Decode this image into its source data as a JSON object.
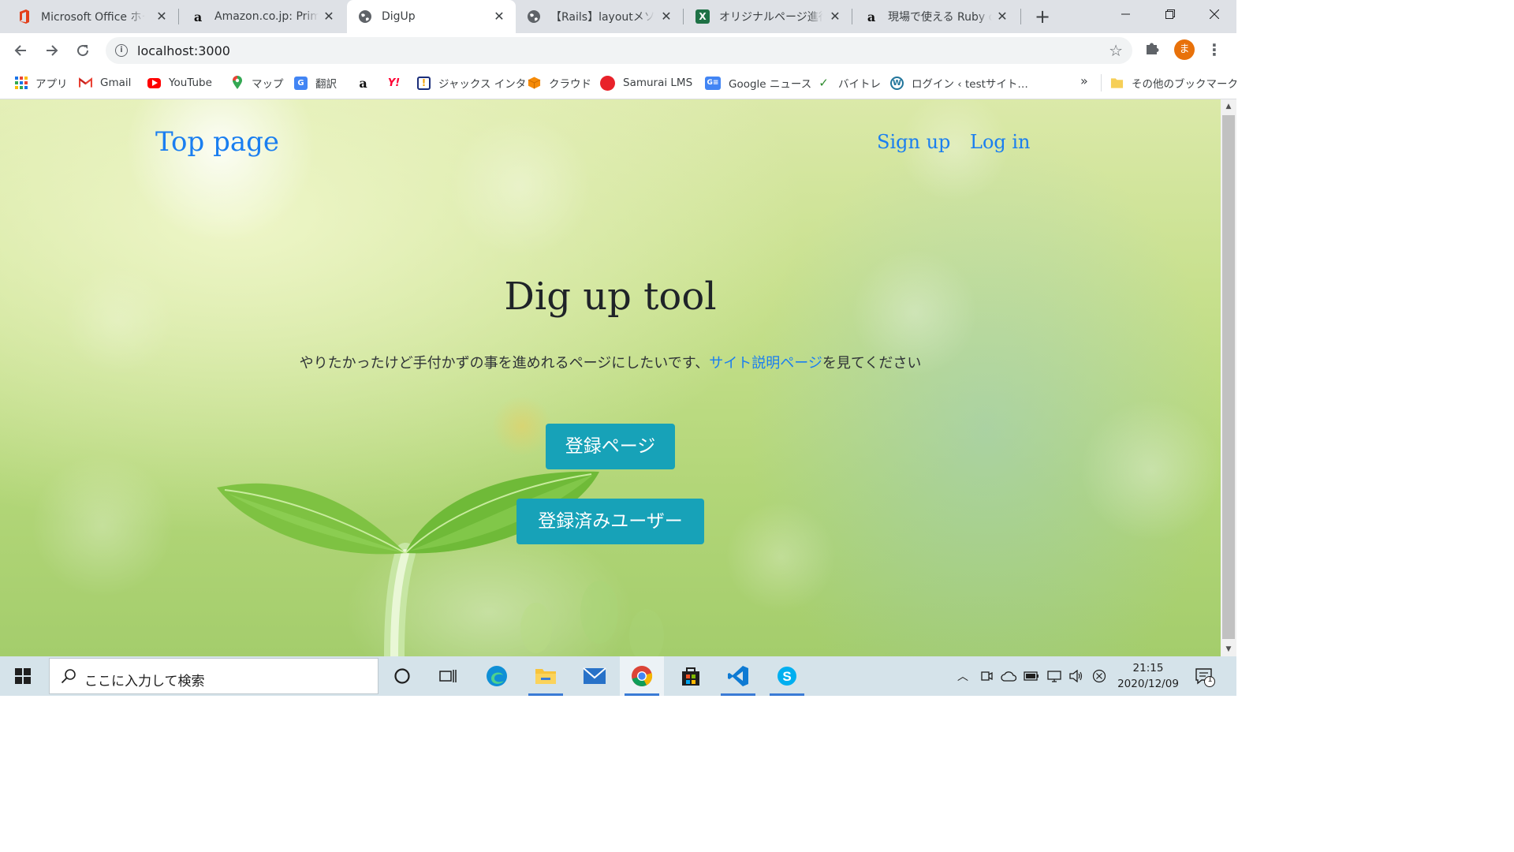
{
  "browser": {
    "tabs": [
      {
        "title": "Microsoft Office ホーム",
        "icon": "office-icon"
      },
      {
        "title": "Amazon.co.jp: Prime",
        "icon": "amazon-icon"
      },
      {
        "title": "DigUp",
        "icon": "globe-icon",
        "active": true
      },
      {
        "title": "【Rails】layoutメソッドの",
        "icon": "globe-icon"
      },
      {
        "title": "オリジナルページ進行メモ",
        "icon": "excel-icon"
      },
      {
        "title": "現場で使える Ruby on",
        "icon": "amazon-icon"
      }
    ],
    "url": "localhost:3000",
    "profile_initial": "ま",
    "bookmarks": [
      {
        "label": "アプリ",
        "icon": "apps-grid-icon"
      },
      {
        "label": "Gmail",
        "icon": "gmail-icon"
      },
      {
        "label": "YouTube",
        "icon": "youtube-icon"
      },
      {
        "label": "マップ",
        "icon": "maps-pin-icon"
      },
      {
        "label": "翻訳",
        "icon": "translate-icon"
      },
      {
        "label": "",
        "icon": "amazon-icon"
      },
      {
        "label": "",
        "icon": "yahoo-icon"
      },
      {
        "label": "ジャックス インタ",
        "icon": "jaccs-icon"
      },
      {
        "label": "クラウド",
        "icon": "cloud-box-icon"
      },
      {
        "label": "Samurai LMS",
        "icon": "samurai-icon"
      },
      {
        "label": "Google ニュース",
        "icon": "google-news-icon"
      },
      {
        "label": "バイトレ",
        "icon": "baitore-icon"
      },
      {
        "label": "ログイン ‹ testサイト…",
        "icon": "wordpress-icon"
      }
    ],
    "bookmarks_overflow": "»",
    "other_bookmarks": "その他のブックマーク"
  },
  "page": {
    "brand": "Top page",
    "nav": {
      "signup": "Sign up",
      "login": "Log in"
    },
    "title": "Dig up tool",
    "subtitle_before": "やりたかったけど手付かずの事を進めれるページにしたいです、",
    "subtitle_link": "サイト説明ページ",
    "subtitle_after": "を見てください",
    "btn_register": "登録ページ",
    "btn_users": "登録済みユーザー"
  },
  "taskbar": {
    "search_placeholder": "ここに入力して検索",
    "time": "21:15",
    "date": "2020/12/09",
    "notifications": "1"
  },
  "colors": {
    "link": "#1a7ef0",
    "button": "#17a2b8",
    "title": "#1f2328"
  }
}
